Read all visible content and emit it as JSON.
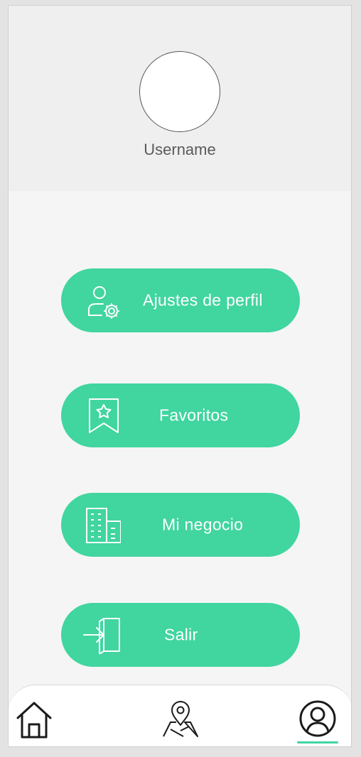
{
  "colors": {
    "accent": "#41d5a0",
    "header_bg": "#efefef",
    "page_bg": "#f5f5f5",
    "icon_stroke": "#ffffff",
    "nav_icon": "#1b1b1b"
  },
  "profile": {
    "username": "Username",
    "avatar_icon": "avatar-circle"
  },
  "menu": {
    "items": [
      {
        "label": "Ajustes de perfil",
        "icon": "user-settings-icon"
      },
      {
        "label": "Favoritos",
        "icon": "bookmark-star-icon"
      },
      {
        "label": "Mi negocio",
        "icon": "building-icon"
      },
      {
        "label": "Salir",
        "icon": "logout-icon"
      }
    ]
  },
  "bottom_nav": {
    "items": [
      {
        "icon": "home-icon"
      },
      {
        "icon": "map-pin-icon"
      },
      {
        "icon": "user-circle-icon",
        "active": true
      }
    ]
  }
}
